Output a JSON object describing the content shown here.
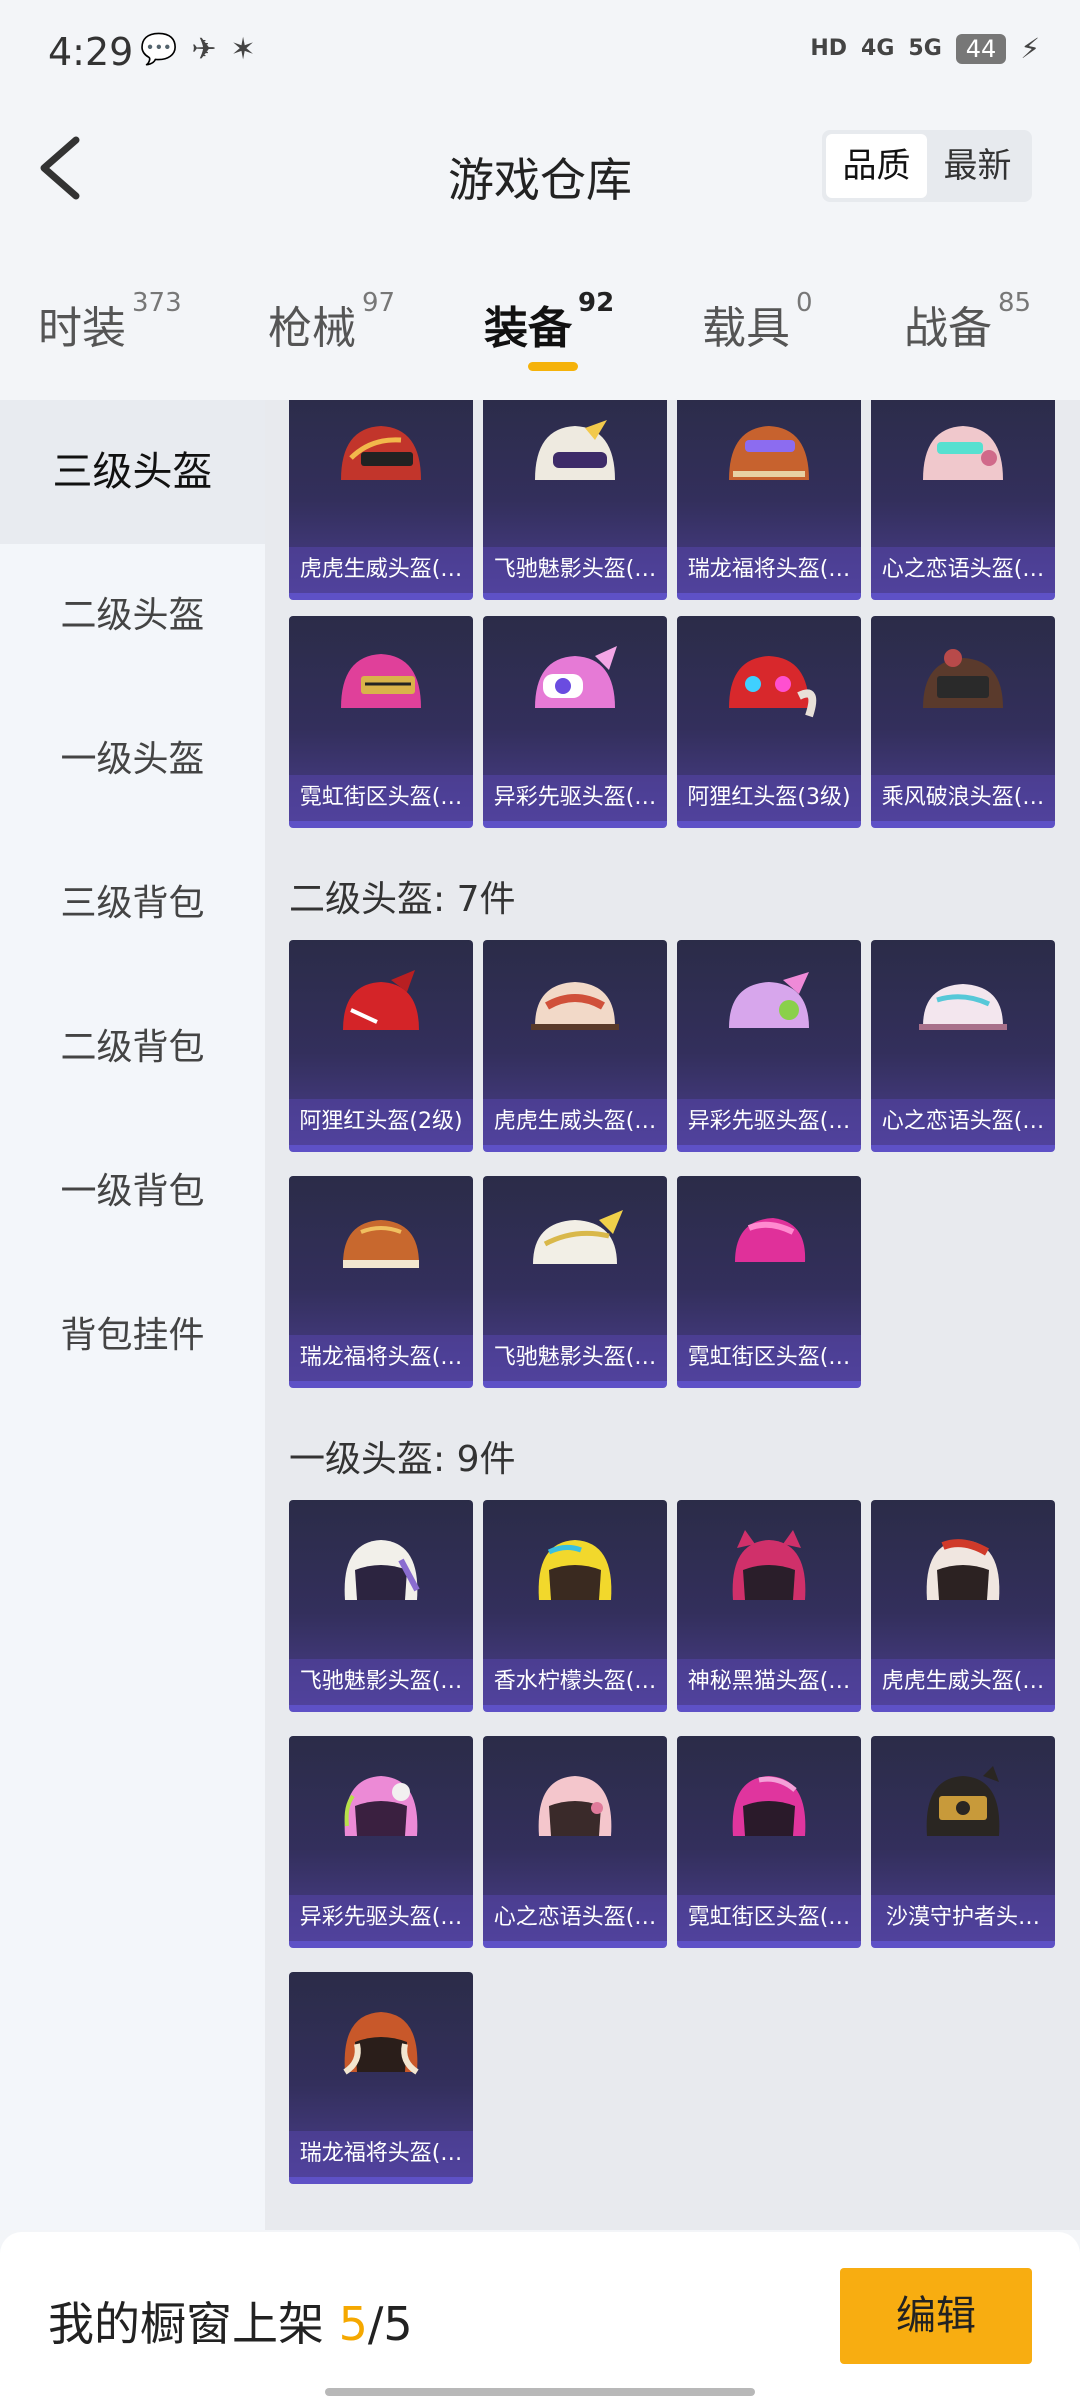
{
  "status_bar": {
    "time": "4:29",
    "hd": "HD",
    "net1": "4G",
    "net2": "5G",
    "battery": "44"
  },
  "header": {
    "title": "游戏仓库",
    "sort_options": [
      "品质",
      "最新"
    ]
  },
  "tabs": [
    {
      "label": "时装",
      "count": "373"
    },
    {
      "label": "枪械",
      "count": "97"
    },
    {
      "label": "装备",
      "count": "92"
    },
    {
      "label": "载具",
      "count": "0"
    },
    {
      "label": "战备",
      "count": "85"
    }
  ],
  "sidebar": [
    "三级头盔",
    "二级头盔",
    "一级头盔",
    "三级背包",
    "二级背包",
    "一级背包",
    "背包挂件"
  ],
  "sections": {
    "level3": {
      "items": [
        "虎虎生威头盔(…",
        "飞驰魅影头盔(…",
        "瑞龙福将头盔(…",
        "心之恋语头盔(…",
        "霓虹街区头盔(…",
        "异彩先驱头盔(…",
        "阿狸红头盔(3级)",
        "乘风破浪头盔(…"
      ]
    },
    "level2": {
      "title": "二级头盔: 7件",
      "items": [
        "阿狸红头盔(2级)",
        "虎虎生威头盔(…",
        "异彩先驱头盔(…",
        "心之恋语头盔(…",
        "瑞龙福将头盔(…",
        "飞驰魅影头盔(…",
        "霓虹街区头盔(…"
      ]
    },
    "level1": {
      "title": "一级头盔: 9件",
      "items": [
        "飞驰魅影头盔(…",
        "香水柠檬头盔(…",
        "神秘黑猫头盔(…",
        "虎虎生威头盔(…",
        "异彩先驱头盔(…",
        "心之恋语头盔(…",
        "霓虹街区头盔(…",
        "沙漠守护者头…",
        "瑞龙福将头盔(…"
      ]
    }
  },
  "bottom": {
    "showcase_prefix": "我的橱窗上架 ",
    "showcase_current": "5",
    "showcase_sep": "/",
    "showcase_total": "5",
    "edit_label": "编辑"
  },
  "colors": {
    "accent": "#f8ad11",
    "card_top": "#2b2c48",
    "card_bottom": "#4a3e8c",
    "card_stripe": "#5e51c6"
  }
}
